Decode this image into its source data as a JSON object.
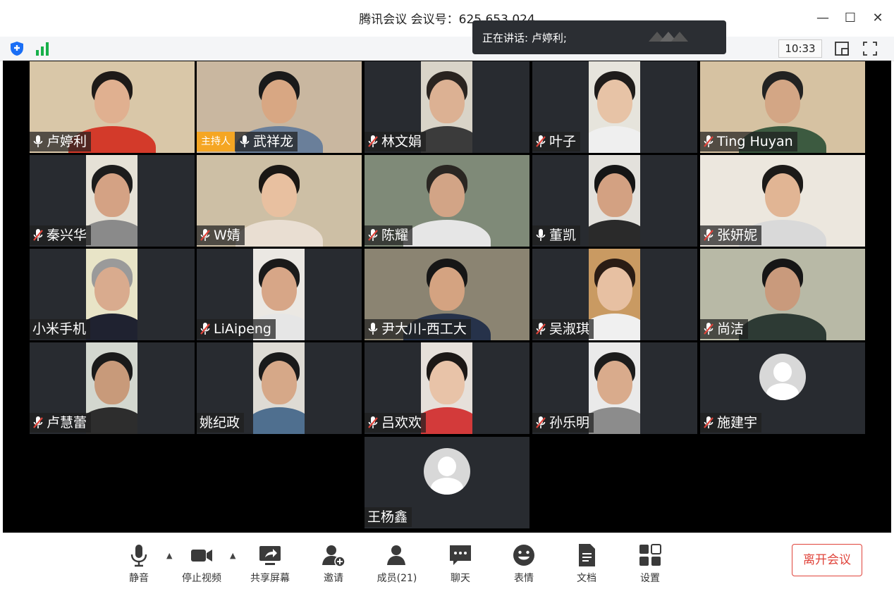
{
  "window": {
    "title": "腾讯会议 会议号：625 653 024",
    "minimize": "—",
    "maximize": "☐",
    "close": "✕"
  },
  "toolbar": {
    "time": "10:33"
  },
  "speaking": {
    "text": "正在讲话: 卢婷利;"
  },
  "host_badge": "主持人",
  "participants": [
    {
      "name": "卢婷利",
      "mic": "on"
    },
    {
      "name": "武祥龙",
      "mic": "on",
      "host": true
    },
    {
      "name": "林文娟",
      "mic": "muted"
    },
    {
      "name": "叶子",
      "mic": "muted"
    },
    {
      "name": "Ting Huyan",
      "mic": "muted"
    },
    {
      "name": "秦兴华",
      "mic": "muted"
    },
    {
      "name": "W婧",
      "mic": "muted"
    },
    {
      "name": "陈耀",
      "mic": "muted"
    },
    {
      "name": "董凯",
      "mic": "on"
    },
    {
      "name": "张妍妮",
      "mic": "muted"
    },
    {
      "name": "小米手机",
      "mic": "none"
    },
    {
      "name": "LiAipeng",
      "mic": "muted"
    },
    {
      "name": "尹大川-西工大",
      "mic": "on"
    },
    {
      "name": "吴淑琪",
      "mic": "muted"
    },
    {
      "name": "尚洁",
      "mic": "muted"
    },
    {
      "name": "卢慧蕾",
      "mic": "muted"
    },
    {
      "name": "姚纪政",
      "mic": "none"
    },
    {
      "name": "吕欢欢",
      "mic": "muted"
    },
    {
      "name": "孙乐明",
      "mic": "muted"
    },
    {
      "name": "施建宇",
      "mic": "muted"
    },
    {
      "name": "王杨鑫",
      "mic": "none"
    }
  ],
  "bottom": {
    "mute": "静音",
    "stop_video": "停止视频",
    "share": "共享屏幕",
    "invite": "邀请",
    "members": "成员(21)",
    "chat": "聊天",
    "reactions": "表情",
    "docs": "文档",
    "settings": "设置",
    "leave": "离开会议"
  },
  "colors": {
    "accent": "#e0443b",
    "host": "#f5a623",
    "stage": "#000000",
    "tile": "#282b30"
  }
}
